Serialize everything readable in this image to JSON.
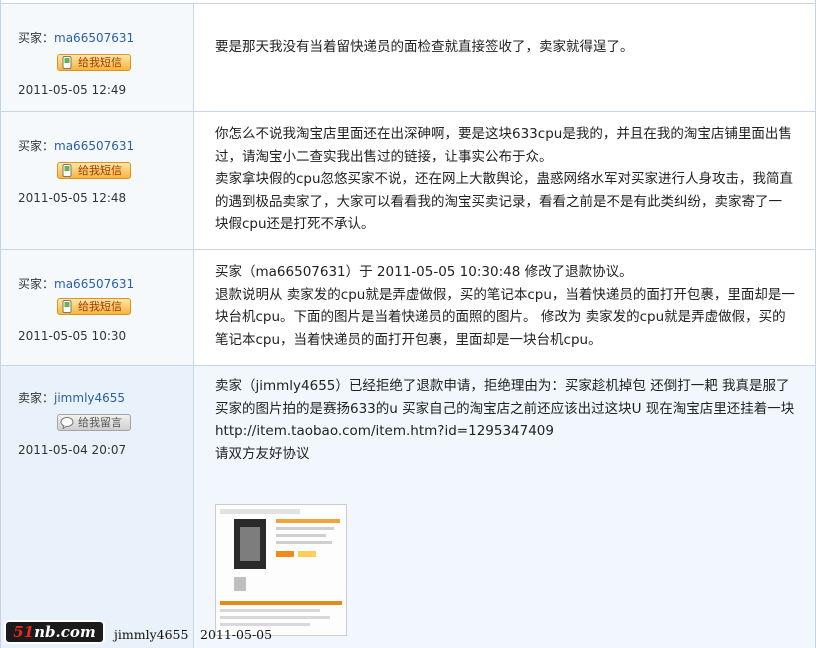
{
  "posts": [
    {
      "role_label": "买家：",
      "username": "ma66507631",
      "button_label": "给我短信",
      "timestamp": "2011-05-05 12:49",
      "paragraphs": [
        "要是那天我没有当着留快递员的面检查就直接签收了，卖家就得逞了。"
      ]
    },
    {
      "role_label": "买家：",
      "username": "ma66507631",
      "button_label": "给我短信",
      "timestamp": "2011-05-05 12:48",
      "paragraphs": [
        "你怎么不说我淘宝店里面还在出深砷啊，要是这块633cpu是我的，并且在我的淘宝店铺里面出售过，请淘宝小二查实我出售过的链接，让事实公布于众。",
        "卖家拿块假的cpu忽悠买家不说，还在网上大散舆论，蛊惑网络水军对买家进行人身攻击，我简直的遇到极品卖家了，大家可以看看我的淘宝买卖记录，看看之前是不是有此类纠纷，卖家寄了一块假cpu还是打死不承认。"
      ]
    },
    {
      "role_label": "买家：",
      "username": "ma66507631",
      "button_label": "给我短信",
      "timestamp": "2011-05-05 10:30",
      "paragraphs": [
        "买家（ma66507631）于 2011-05-05 10:30:48 修改了退款协议。",
        "退款说明从 卖家发的cpu就是弄虚做假，买的笔记本cpu，当着快递员的面打开包裹，里面却是一块台机cpu。下面的图片是当着快递员的面照的图片。 修改为 卖家发的cpu就是弄虚做假，买的笔记本cpu，当着快递员的面打开包裹，里面却是一块台机cpu。"
      ]
    },
    {
      "role_label": "卖家：",
      "username": "jimmly4655",
      "button_label": "给我留言",
      "timestamp": "2011-05-04 20:07",
      "paragraphs": [
        "卖家（jimmly4655）已经拒绝了退款申请，拒绝理由为：买家趁机掉包 还倒打一耙 我真是服了",
        "买家的图片拍的是赛扬633的u 买家自己的淘宝店之前还应该出过这块U 现在淘宝店里还挂着一块http://item.taobao.com/item.htm?id=1295347409",
        "请双方友好协议"
      ]
    }
  ],
  "footer": {
    "logo_a": "51",
    "logo_b": "nb.com",
    "user": "jimmly4655",
    "date": "2011-05-05"
  },
  "colors": {
    "link": "#2a5fa8",
    "button_orange": "#f7b53e",
    "button_gray": "#cfcfcf",
    "row_border": "#c8d6e4"
  }
}
